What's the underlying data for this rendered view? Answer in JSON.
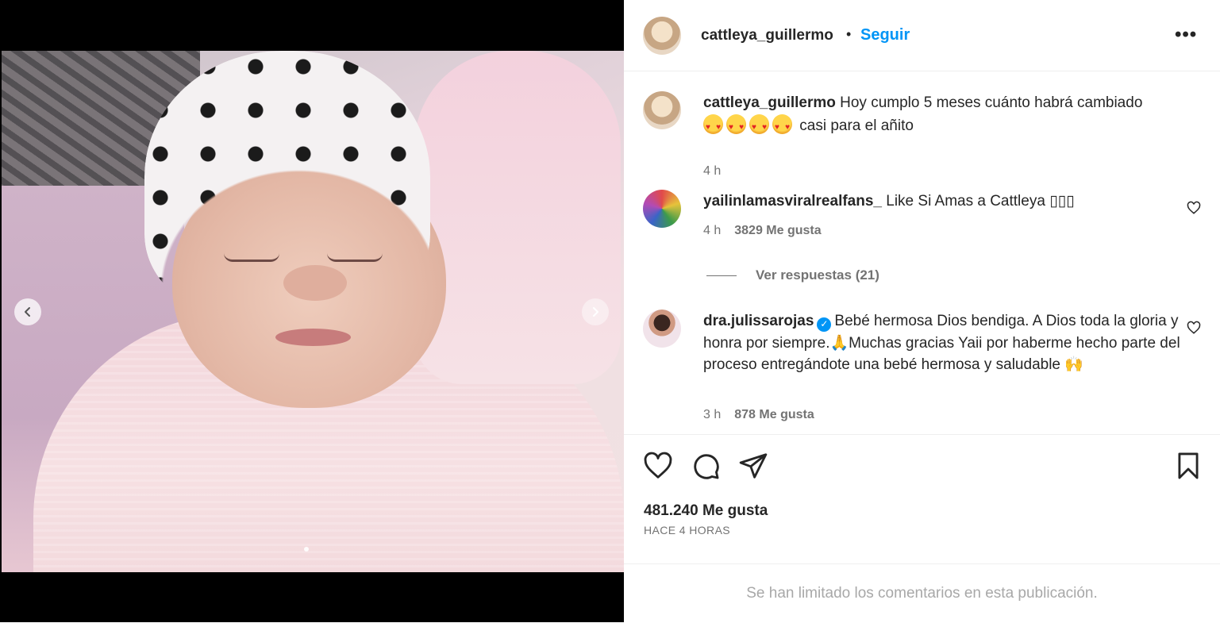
{
  "post": {
    "carousel": {
      "prev_icon": "chevron-left-icon",
      "next_icon": "chevron-right-icon"
    }
  },
  "header": {
    "username": "cattleya_guillermo",
    "separator": "•",
    "follow_label": "Seguir",
    "more_icon": "more-horizontal-icon",
    "more_label": "•••"
  },
  "caption": {
    "username": "cattleya_guillermo",
    "text_1": "Hoy cumplo 5 meses cuánto habrá cambiado",
    "text_2": "casi para el añito",
    "emoji_count": 4,
    "time": "4 h"
  },
  "comments": [
    {
      "username": "yailinlamasviralrealfans_",
      "text": "Like Si Amas a Cattleya ▯▯▯",
      "time": "4 h",
      "likes": "3829 Me gusta",
      "replies": "Ver respuestas (21)"
    },
    {
      "username": "dra.julissarojas",
      "verified": true,
      "text": "Bebé hermosa Dios bendiga. A Dios toda la gloria y honra por siempre.🙏Muchas gracias Yaii por haberme hecho parte del proceso entregándote una bebé hermosa y saludable 🙌",
      "time": "3 h",
      "likes": "878 Me gusta"
    }
  ],
  "actions": {
    "icons": [
      "heart-icon",
      "comment-icon",
      "share-icon",
      "bookmark-icon"
    ]
  },
  "stats": {
    "likes": "481.240 Me gusta",
    "time_ago": "HACE 4 HORAS"
  },
  "footer": {
    "notice": "Se han limitado los comentarios en esta publicación."
  },
  "colors": {
    "accent": "#0095f6",
    "text": "#262626",
    "muted": "#737373",
    "divider": "#efefef"
  }
}
